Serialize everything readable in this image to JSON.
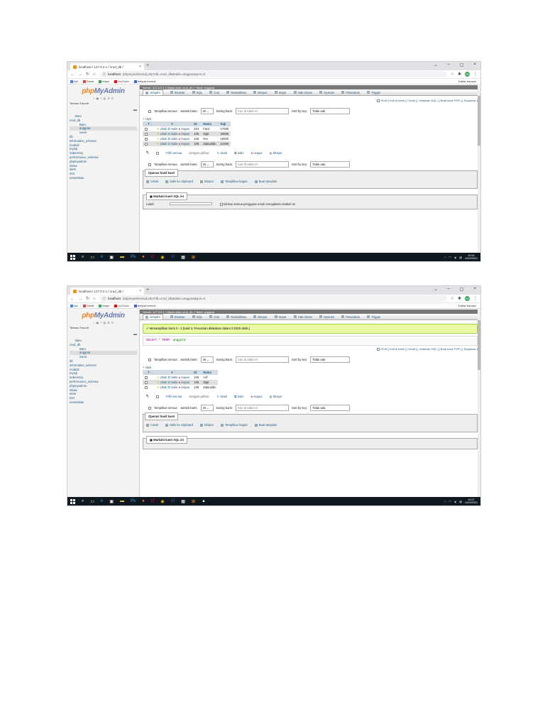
{
  "browser": {
    "tab_title": "localhost / 127.0.0.1 / crud_db /",
    "tab_close": "×",
    "new_tab": "+",
    "win_min": "–",
    "win_max": "▢",
    "win_close": "×",
    "url_host": "localhost",
    "url_path": "/phpmyadmin/sql.php?db=crud_db&table=anggota&pos=0",
    "bookmarks": [
      "Apl",
      "Gmail",
      "Maps",
      "YouTube",
      "tempat remedi"
    ],
    "reading_list": "Daftar bacaan",
    "avatar": "PB"
  },
  "pma": {
    "logo_php": "php",
    "logo_rest": "MyAdmin",
    "left_tabs": "Terbaru  Favorit",
    "tree1": [
      "Baru",
      "crud_db",
      "Baru",
      "anggota",
      "users",
      "db",
      "information_schema",
      "modul2",
      "mysql",
      "orderentry",
      "performance_schema",
      "phpmyadmin",
      "siswa",
      "sirek",
      "test",
      "universitas"
    ],
    "breadcrumb": "Server: 127.0.0.1 » Basis data: crud_db » Tabel: anggota",
    "tabs": [
      "Jelajahi",
      "Struktur",
      "SQL",
      "Cari",
      "Tambahkan",
      "Ekspor",
      "Impor",
      "Hak Akses",
      "Operasi",
      "Pelacakan",
      "Trigger"
    ],
    "links": "Profil [ Edit di baris ] [ Ubah ] [ Jelaskan SQL ] [ Buat kode PHP ] [ Segarkan ]",
    "tampilkan": "Tampilkan semua",
    "jumlah": "Jumlah baris:",
    "jumlah_val": "25",
    "saring": "Saring baris:",
    "saring_ph": "Cari di tabel ini",
    "sort": "Sort by key:",
    "sort_val": "Tidak ada",
    "opsi": "+ Opsi",
    "pilih_semua": "Pilih Semua",
    "dengan_pilihan": "Dengan pilihan:",
    "ubah": "Ubah",
    "salin": "Salin",
    "hapus": "Hapus",
    "ekspor": "Ekspor",
    "op_legend": "Operasi hasil kueri",
    "qops": [
      "Cetak",
      "Salin ke clipboard",
      "Ekspor",
      "Tampilkan bagan",
      "Buat tampilan"
    ],
    "bookmark_legend": "Markahi kueri SQL ini",
    "bookmark_note": "Izinkan semua pengguna untuk mengakses markah ini",
    "label": "Label:",
    "console": "Konsol"
  },
  "shot1": {
    "headers": [
      "ID",
      "Nama",
      "Gaji"
    ],
    "rows": [
      [
        "104",
        "Fariz",
        "17000"
      ],
      [
        "105",
        "Sigit",
        "20000"
      ],
      [
        "106",
        "Ilen",
        "16000"
      ],
      [
        "108",
        "Zakiuddin",
        "21000"
      ]
    ],
    "clock_time": "10:15",
    "clock_date": "14/10/2021"
  },
  "shot2": {
    "success": "Menampilkan baris 0 - 2 (total 3, Pencarian dilakukan dalam 0.0320 detik.)",
    "sql_kw": "SELECT",
    "sql_star": " * ",
    "sql_from": "FROM",
    "sql_tbl": " `anggota`",
    "headers": [
      "ID",
      "Nama"
    ],
    "rows": [
      [
        "105",
        "Arif"
      ],
      [
        "105",
        "Sigit"
      ],
      [
        "108",
        "Zakiuddin"
      ]
    ],
    "clock_time": "10:27",
    "clock_date": "14/10/2021"
  }
}
